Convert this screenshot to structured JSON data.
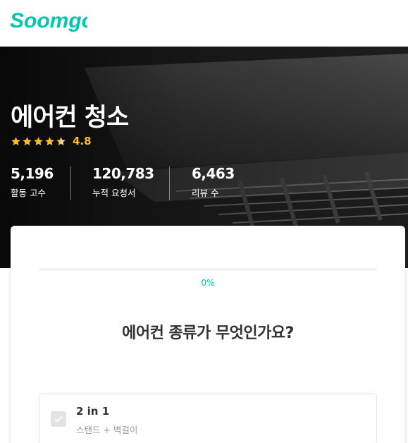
{
  "brand": {
    "logo_text": "Soomgo",
    "color": "#00c7ae"
  },
  "service": {
    "title": "에어컨 청소",
    "rating": "4.8",
    "stars_filled": 4.5,
    "rating_color": "#ffbf1f"
  },
  "stats": [
    {
      "value": "5,196",
      "label": "활동 고수"
    },
    {
      "value": "120,783",
      "label": "누적 요청서"
    },
    {
      "value": "6,463",
      "label": "리뷰 수"
    }
  ],
  "quiz": {
    "progress": 0,
    "progress_label": "0%",
    "question": "에어컨 종류가 무엇인가요?",
    "options": [
      {
        "title": "2 in 1",
        "subtitle": "스탠드 + 벽걸이",
        "checked": false
      }
    ]
  },
  "icons": {
    "star": "star-icon",
    "check": "check-icon"
  }
}
